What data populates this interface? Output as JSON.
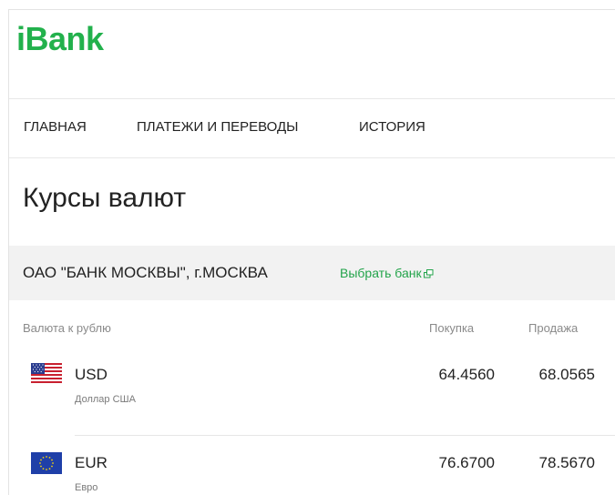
{
  "app": {
    "logo": "iBank"
  },
  "nav": {
    "items": [
      {
        "label": "ГЛАВНАЯ"
      },
      {
        "label": "ПЛАТЕЖИ И ПЕРЕВОДЫ"
      },
      {
        "label": "ИСТОРИЯ"
      }
    ]
  },
  "page": {
    "title": "Курсы валют"
  },
  "bank": {
    "name": "ОАО \"БАНК МОСКВЫ\", г.МОСКВА",
    "choose_label": "Выбрать банк",
    "choose_icon": "external-link-icon"
  },
  "table": {
    "headers": {
      "currency": "Валюта к рублю",
      "buy": "Покупка",
      "sell": "Продажа"
    },
    "rows": [
      {
        "code": "USD",
        "name": "Доллар США",
        "buy": "64.4560",
        "sell": "68.0565",
        "flag": "us-flag-icon"
      },
      {
        "code": "EUR",
        "name": "Евро",
        "buy": "76.6700",
        "sell": "78.5670",
        "flag": "eu-flag-icon"
      }
    ]
  },
  "colors": {
    "brand_green": "#22b14c",
    "link_green": "#22a34a",
    "bank_bar_bg": "#f2f2f2"
  }
}
